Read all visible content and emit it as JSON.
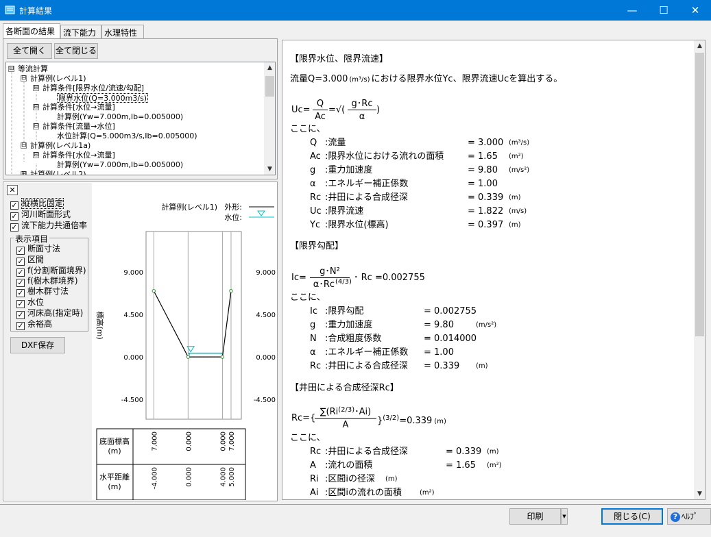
{
  "window": {
    "title": "計算結果",
    "min": "—",
    "max": "☐",
    "close": "✕"
  },
  "tabs": [
    "各断面の結果",
    "流下能力",
    "水理特性"
  ],
  "toolbar": {
    "expand_all": "全て開く",
    "collapse_all": "全て閉じる"
  },
  "tree": [
    {
      "label": "等流計算",
      "sign": "⊟"
    },
    {
      "label": "計算例(レベル1)",
      "sign": "⊟"
    },
    {
      "label": "計算条件[限界水位/流速/勾配]",
      "sign": "⊟"
    },
    {
      "label": "限界水位(Q=3.000m3/s)",
      "sign": ""
    },
    {
      "label": "計算条件[水位→流量]",
      "sign": "⊟"
    },
    {
      "label": "計算例(Yw=7.000m,Ib=0.005000)",
      "sign": ""
    },
    {
      "label": "計算条件[流量→水位]",
      "sign": "⊟"
    },
    {
      "label": "水位計算(Q=5.000m3/s,Ib=0.005000)",
      "sign": ""
    },
    {
      "label": "計算例(レベル1a)",
      "sign": "⊟"
    },
    {
      "label": "計算条件[水位→流量]",
      "sign": "⊟"
    },
    {
      "label": "計算例(Yw=7.000m,Ib=0.005000)",
      "sign": ""
    },
    {
      "label": "計算例(レベル2)",
      "sign": "⊞"
    }
  ],
  "options": {
    "close_box": "✕",
    "check": "✓",
    "items": [
      "縦横比固定",
      "河川断面形式",
      "流下能力共通倍率"
    ]
  },
  "display_group": {
    "label": "表示項目",
    "items": [
      "断面寸法",
      "区間",
      "f(分割断面境界)",
      "f(樹木群境界)",
      "樹木群寸法",
      "水位",
      "河床高(指定時)",
      "余裕高"
    ]
  },
  "dxf_button": "DXF保存",
  "chart": {
    "legend_name": "計算例(レベル1)",
    "legend_shape": "外形:",
    "legend_water": "水位:",
    "ylabel": "標高(m)",
    "yticks": [
      "9.000",
      "4.500",
      "0.000",
      "-4.500"
    ],
    "table_row1_label": "底面標高\n(m)",
    "table_row2_label": "水平距離\n(m)",
    "elev_labels": [
      "7.000",
      "0.000",
      "0.000",
      "7.000"
    ],
    "dist_labels": [
      "-4.000",
      "0.000",
      "4.000",
      "5.000"
    ]
  },
  "chart_data": {
    "type": "line",
    "x": [
      -4.0,
      0.0,
      4.0,
      5.0
    ],
    "y": [
      7.0,
      0.0,
      0.0,
      7.0
    ],
    "water_level": 0.397,
    "ylim": [
      -6.6,
      13.3
    ],
    "ylabel": "標高(m)",
    "series": [
      {
        "name": "外形:",
        "values": [
          7.0,
          0.0,
          0.0,
          7.0
        ]
      }
    ]
  },
  "report": {
    "h1": "【限界水位、限界流速】",
    "intro_a": "流量Q=3.000",
    "intro_unit": "(m³/s)",
    "intro_b": "における限界水位Yc、限界流速Ucを算出する。",
    "uc_lhs": "Uc=",
    "uc_num": "Q",
    "uc_den": "Ac",
    "uc_mid": "=√(",
    "uc_num2": "g･Rc",
    "uc_den2": "α",
    "uc_close": ")",
    "koko": "ここに、",
    "vars1": [
      {
        "s": "Q",
        "d": ":流量",
        "v": "= 3.000",
        "u": "(m³/s)"
      },
      {
        "s": "Ac",
        "d": ":限界水位における流れの面積",
        "v": "=  1.65",
        "u": "(m²)"
      },
      {
        "s": "g",
        "d": ":重力加速度",
        "v": "=  9.80",
        "u": "(m/s²)"
      },
      {
        "s": "α",
        "d": ":エネルギー補正係数",
        "v": "=  1.00",
        "u": ""
      },
      {
        "s": "Rc",
        "d": ":井田による合成径深",
        "v": "= 0.339",
        "u": "(m)"
      },
      {
        "s": "Uc",
        "d": ":限界流速",
        "v": "= 1.822",
        "u": "(m/s)"
      },
      {
        "s": "Yc",
        "d": ":限界水位(標高)",
        "v": "= 0.397",
        "u": "(m)"
      }
    ],
    "h2": "【限界勾配】",
    "ic_lhs": "Ic=",
    "ic_num": "g･N²",
    "ic_den": "α･Rc",
    "ic_exp": "(4/3)",
    "ic_rest": "･ Rc =0.002755",
    "vars2": [
      {
        "s": "Ic",
        "d": ":限界勾配",
        "v": "= 0.002755",
        "u": ""
      },
      {
        "s": "g",
        "d": ":重力加速度",
        "v": "=        9.80",
        "u": "(m/s²)"
      },
      {
        "s": "N",
        "d": ":合成粗度係数",
        "v": "= 0.014000",
        "u": ""
      },
      {
        "s": "α",
        "d": ":エネルギー補正係数",
        "v": "=        1.00",
        "u": ""
      },
      {
        "s": "Rc",
        "d": ":井田による合成径深",
        "v": "=      0.339",
        "u": "(m)"
      }
    ],
    "h3": "【井田による合成径深Rc】",
    "rc_lhs": "Rc={",
    "rc_num": "∑(Ri",
    "rc_num_exp": "(2/3)",
    "rc_num_rest": "･Ai)",
    "rc_den": "A",
    "rc_close": "}",
    "rc_exp": "(3/2)",
    "rc_val": "=0.339",
    "rc_unit": "(m)",
    "vars3": [
      {
        "s": "Rc",
        "d": ":井田による合成径深",
        "v": "= 0.339",
        "u": "(m)"
      },
      {
        "s": "A",
        "d": ":流れの面積",
        "v": "=   1.65",
        "u": "(m²)"
      },
      {
        "s": "Ri",
        "d": ":区間iの径深",
        "v": "",
        "u": "(m)"
      },
      {
        "s": "Ai",
        "d": ":区間iの流れの面積",
        "v": "",
        "u": "(m²)"
      }
    ]
  },
  "bottom": {
    "print": "印刷",
    "close": "閉じる(C)",
    "help": "ﾍﾙﾌﾟ(H)",
    "dropdown": "▼"
  },
  "colors": {
    "titlebar": "#0078d7",
    "water": "#00bfbf",
    "shape": "#000000"
  }
}
